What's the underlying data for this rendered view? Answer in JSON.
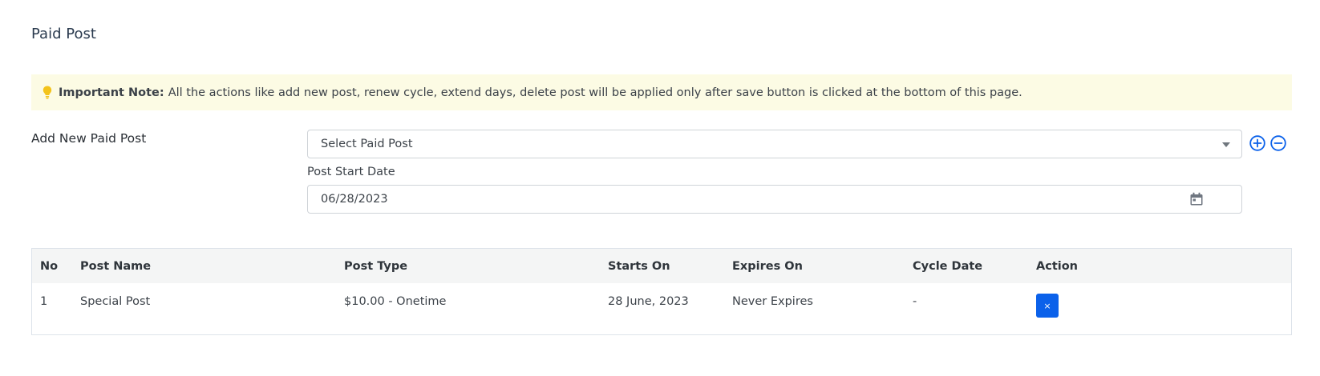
{
  "page": {
    "title": "Paid Post"
  },
  "note": {
    "label": "Important Note:",
    "text": "All the actions like add new post, renew cycle, extend days, delete post will be applied only after save button is clicked at the bottom of this page."
  },
  "form": {
    "label": "Add New Paid Post",
    "select_value": "Select Paid Post",
    "start_date_label": "Post Start Date",
    "start_date_value": "06/28/2023"
  },
  "table": {
    "headers": [
      "No",
      "Post Name",
      "Post Type",
      "Starts On",
      "Expires On",
      "Cycle Date",
      "Action"
    ],
    "rows": [
      {
        "no": "1",
        "post_name": "Special Post",
        "post_type": "$10.00 - Onetime",
        "starts_on": "28 June, 2023",
        "expires_on": "Never Expires",
        "cycle_date": "-",
        "action_label": "×"
      }
    ]
  },
  "colors": {
    "accent": "#0b61ea",
    "note_bg": "#fcfbe4",
    "bulb": "#f3c31b"
  },
  "icons": {
    "note": "lightbulb-icon",
    "add": "plus-circle-icon",
    "remove": "minus-circle-icon",
    "calendar": "calendar-icon",
    "dropdown": "caret-down-icon"
  }
}
